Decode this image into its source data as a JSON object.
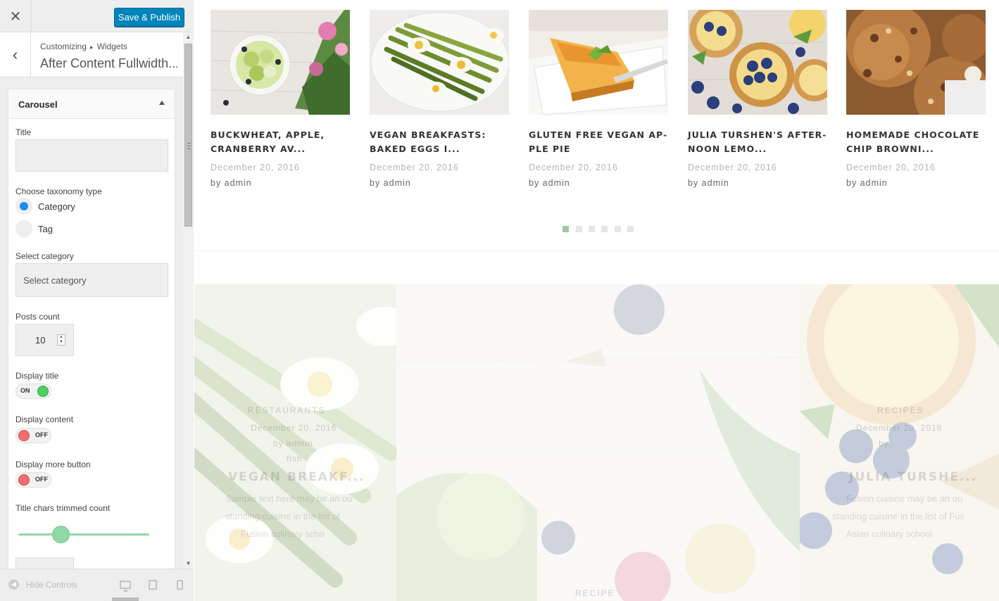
{
  "toolbar": {
    "close_icon": "close-icon",
    "publish_label": "Save & Publish"
  },
  "breadcrumb": {
    "path_root": "Customizing",
    "path_sep": "▸",
    "path_leaf": "Widgets",
    "title": "After Content Fullwidth..."
  },
  "widget": {
    "title": "Carousel",
    "fields": {
      "title_label": "Title",
      "title_value": "",
      "taxonomy_label": "Choose taxonomy type",
      "taxonomy_options": [
        "Category",
        "Tag"
      ],
      "taxonomy_selected": "Category",
      "category_label": "Select category",
      "category_placeholder": "Select category",
      "posts_count_label": "Posts count",
      "posts_count_value": "10",
      "display_title_label": "Display title",
      "display_title_state": "ON",
      "display_content_label": "Display content",
      "display_content_state": "OFF",
      "display_more_label": "Display more button",
      "display_more_state": "OFF",
      "trim_label": "Title chars trimmed count"
    }
  },
  "footer": {
    "hide_label": "Hide Controls",
    "devices": [
      "desktop-icon",
      "tablet-icon",
      "mobile-icon"
    ]
  },
  "carousel": {
    "posts": [
      {
        "title": "BUCKWHEAT, APPLE, CRANBERRY AV...",
        "date": "December 20, 2016",
        "author": "by admin"
      },
      {
        "title": "VEGAN BREAKFASTS: BAKED EGGS I...",
        "date": "December 20, 2016",
        "author": "by admin"
      },
      {
        "title": "GLUTEN FREE VEGAN AP-PLE PIE",
        "date": "December 20, 2016",
        "author": "by admin"
      },
      {
        "title": "JULIA TURSHEN'S AFTER-NOON LEMO...",
        "date": "December 20, 2016",
        "author": "by admin"
      },
      {
        "title": "HOMEMADE CHOCOLATE CHIP BROWNI...",
        "date": "December 20, 2016",
        "author": "by admin"
      }
    ],
    "page_count": 6,
    "active_page": 1
  },
  "hero": {
    "left": {
      "category": "RESTAURANTS",
      "date": "December 20, 2016",
      "author": "by admin",
      "tag": "fish",
      "title": "VEGAN BREAKF...",
      "excerpt": [
        "Sample text here may be an ou",
        "standing cuisine in the list of",
        "Fusion culinary scho"
      ]
    },
    "bottom_label": "RECIPE",
    "right": {
      "category": "RECIPES",
      "date": "December 20, 2016",
      "author": "by",
      "title": "JULIA TURSHE...",
      "excerpt": [
        "Fusion cuisine may be an ou",
        "standing cuisine in the list of Fus",
        "Asian culinary school"
      ]
    }
  },
  "colors": {
    "publish": "#0085ba",
    "toggle_on": "#4cd065",
    "toggle_off": "#ef6f6f",
    "radio_selected": "#1e8cf1",
    "slider": "#8fd9a6",
    "dot_active": "#9dc7a5"
  }
}
